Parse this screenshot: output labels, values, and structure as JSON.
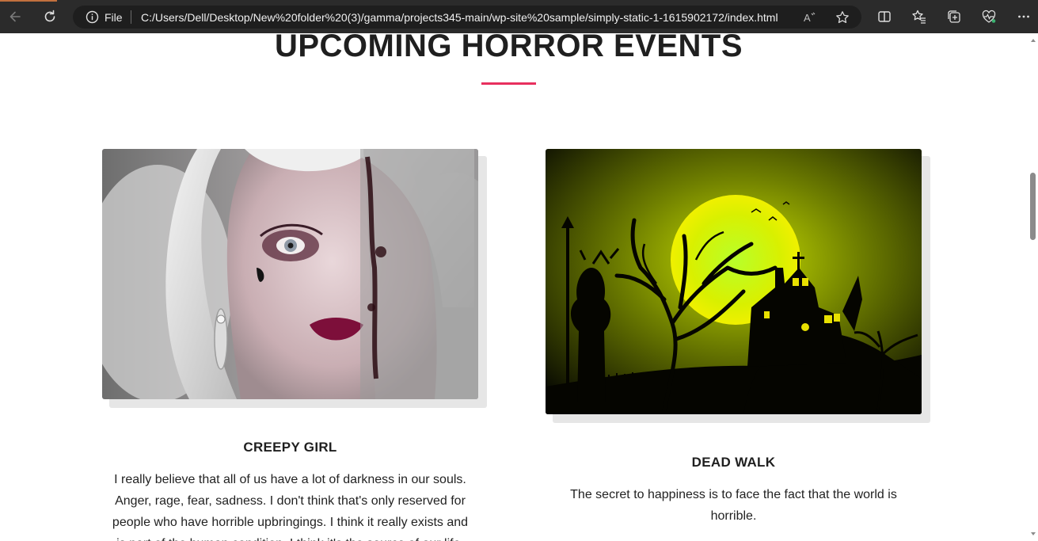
{
  "browser": {
    "file_label": "File",
    "url": "C:/Users/Dell/Desktop/New%20folder%20(3)/gamma/projects345-main/wp-site%20sample/simply-static-1-1615902172/index.html",
    "icons": [
      "back-icon",
      "refresh-icon",
      "info-icon",
      "read-aloud-icon",
      "favorite-star-icon",
      "split-screen-icon",
      "favorites-icon",
      "collections-icon",
      "health-icon",
      "more-icon"
    ]
  },
  "section": {
    "heading": "UPCOMING HORROR EVENTS",
    "accent_color": "#e8305e"
  },
  "events": [
    {
      "title": "CREEPY GIRL",
      "text": "I really believe that all of us have a lot of darkness in our souls. Anger, rage, fear, sadness. I don't think that's only reserved for people who have horrible upbringings. I think it really exists and is part of the human condition. I think it's the source of our life."
    },
    {
      "title": "DEAD WALK",
      "text": "The secret to happiness is to face the fact that the world is horrible."
    }
  ]
}
